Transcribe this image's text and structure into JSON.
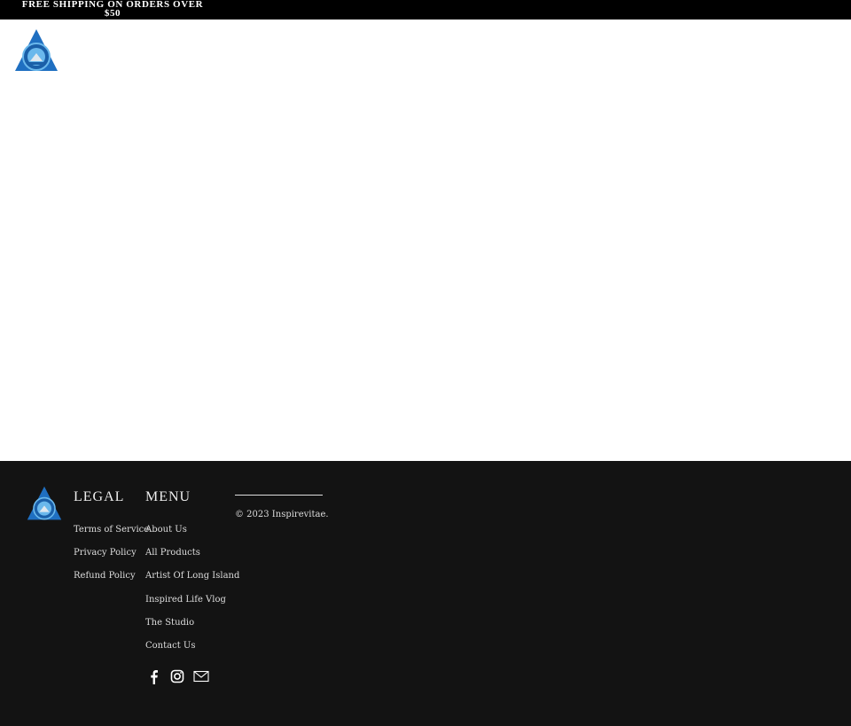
{
  "announcement": "FREE SHIPPING ON ORDERS OVER $50",
  "brand": {
    "logo_alt": "Inspirevitae",
    "primary_color": "#1f6fc1",
    "light_color": "#6ab8ec"
  },
  "footer": {
    "legal": {
      "title": "LEGAL",
      "links": [
        "Terms of Service",
        "Privacy Policy",
        "Refund Policy"
      ]
    },
    "menu": {
      "title": "MENU",
      "links": [
        "About Us",
        "All Products",
        "Artist Of Long Island",
        "Inspired Life Vlog",
        "The Studio",
        "Contact Us"
      ]
    },
    "copyright": "© 2023 Inspirevitae.",
    "social": [
      "facebook-icon",
      "instagram-icon",
      "email-icon"
    ]
  }
}
